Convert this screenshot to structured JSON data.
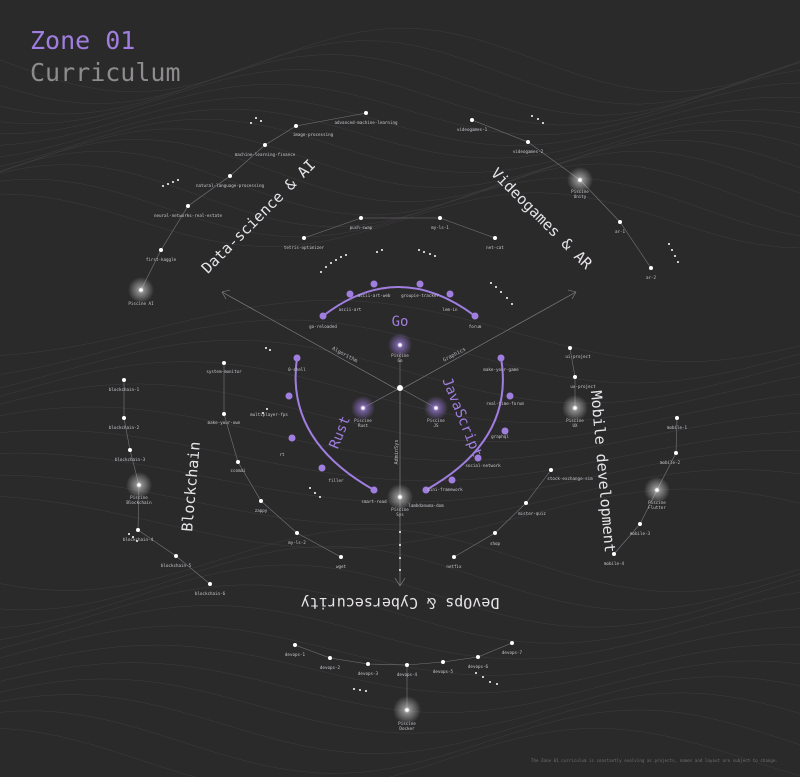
{
  "header": {
    "title": "Zone 01",
    "subtitle": "Curriculum"
  },
  "colors": {
    "background": "#2b2a2b",
    "accent": "#a07ee0",
    "node": "#ffffff",
    "muted": "#8e8c8e"
  },
  "footer_note": "The Zone 01 curriculum is constantly evolving as projects, names and layout are subject to change.",
  "center": {
    "core": [
      "Go",
      "Rust",
      "JavaScript"
    ],
    "branches": [
      "Algorithm",
      "Graphics",
      "AdminSys"
    ],
    "piscines": [
      "Piscine Go",
      "Piscine Rust",
      "Piscine JS",
      "Piscine Sys"
    ]
  },
  "go_projects": [
    "go-reloaded",
    "ascii-art",
    "ascii-art-web",
    "groupie-tracker",
    "lem-in",
    "forum"
  ],
  "rust_projects": [
    "0-shell",
    "multiplayer-fps",
    "rt",
    "filler",
    "smart-road"
  ],
  "js_projects": [
    "make-your-game",
    "real-time-forum",
    "graphql",
    "social-network",
    "mini-framework",
    "lambdanuma-dom"
  ],
  "zones": {
    "data_ai": {
      "label": "Data-science & AI",
      "piscine": "Piscine AI",
      "projects": [
        "advanced-machine-learning",
        "image-processing",
        "machine-learning-finance",
        "natural-language-processing",
        "neural-networks-real-estate",
        "first-kaggle"
      ]
    },
    "videogames": {
      "label": "Videogames & AR",
      "piscine": "Piscine Unity",
      "projects": [
        "videogames-1",
        "videogames-2",
        "ar-1",
        "ar-2"
      ]
    },
    "mobile": {
      "label": "Mobile development",
      "piscine_ux": "Piscine UX",
      "piscine_flutter": "Piscine Flutter",
      "projects": [
        "ui-project",
        "ux-project",
        "mobile-1",
        "mobile-2",
        "mobile-3",
        "mobile-4"
      ]
    },
    "devops": {
      "label": "DevOps & Cybersecurity",
      "piscine": "Piscine Docker",
      "projects": [
        "devops-1",
        "devops-2",
        "devops-3",
        "devops-4",
        "devops-5",
        "devops-6",
        "devops-7"
      ]
    },
    "blockchain": {
      "label": "Blockchain",
      "piscine": "Piscine Blockchain",
      "projects": [
        "blockchain-1",
        "blockchain-2",
        "blockchain-3",
        "blockchain-4",
        "blockchain-5",
        "blockchain-6"
      ]
    }
  },
  "inner_left": [
    "system-monitor",
    "make-your-own",
    "ccomai",
    "zappy",
    "my-ls-2",
    "wget"
  ],
  "inner_right": [
    "stock-exchange-sim",
    "mister-quiz",
    "shop",
    "netfix"
  ],
  "inner_top": [
    "tetris-optimizer",
    "push-swap",
    "my-ls-1",
    "net-cat"
  ]
}
